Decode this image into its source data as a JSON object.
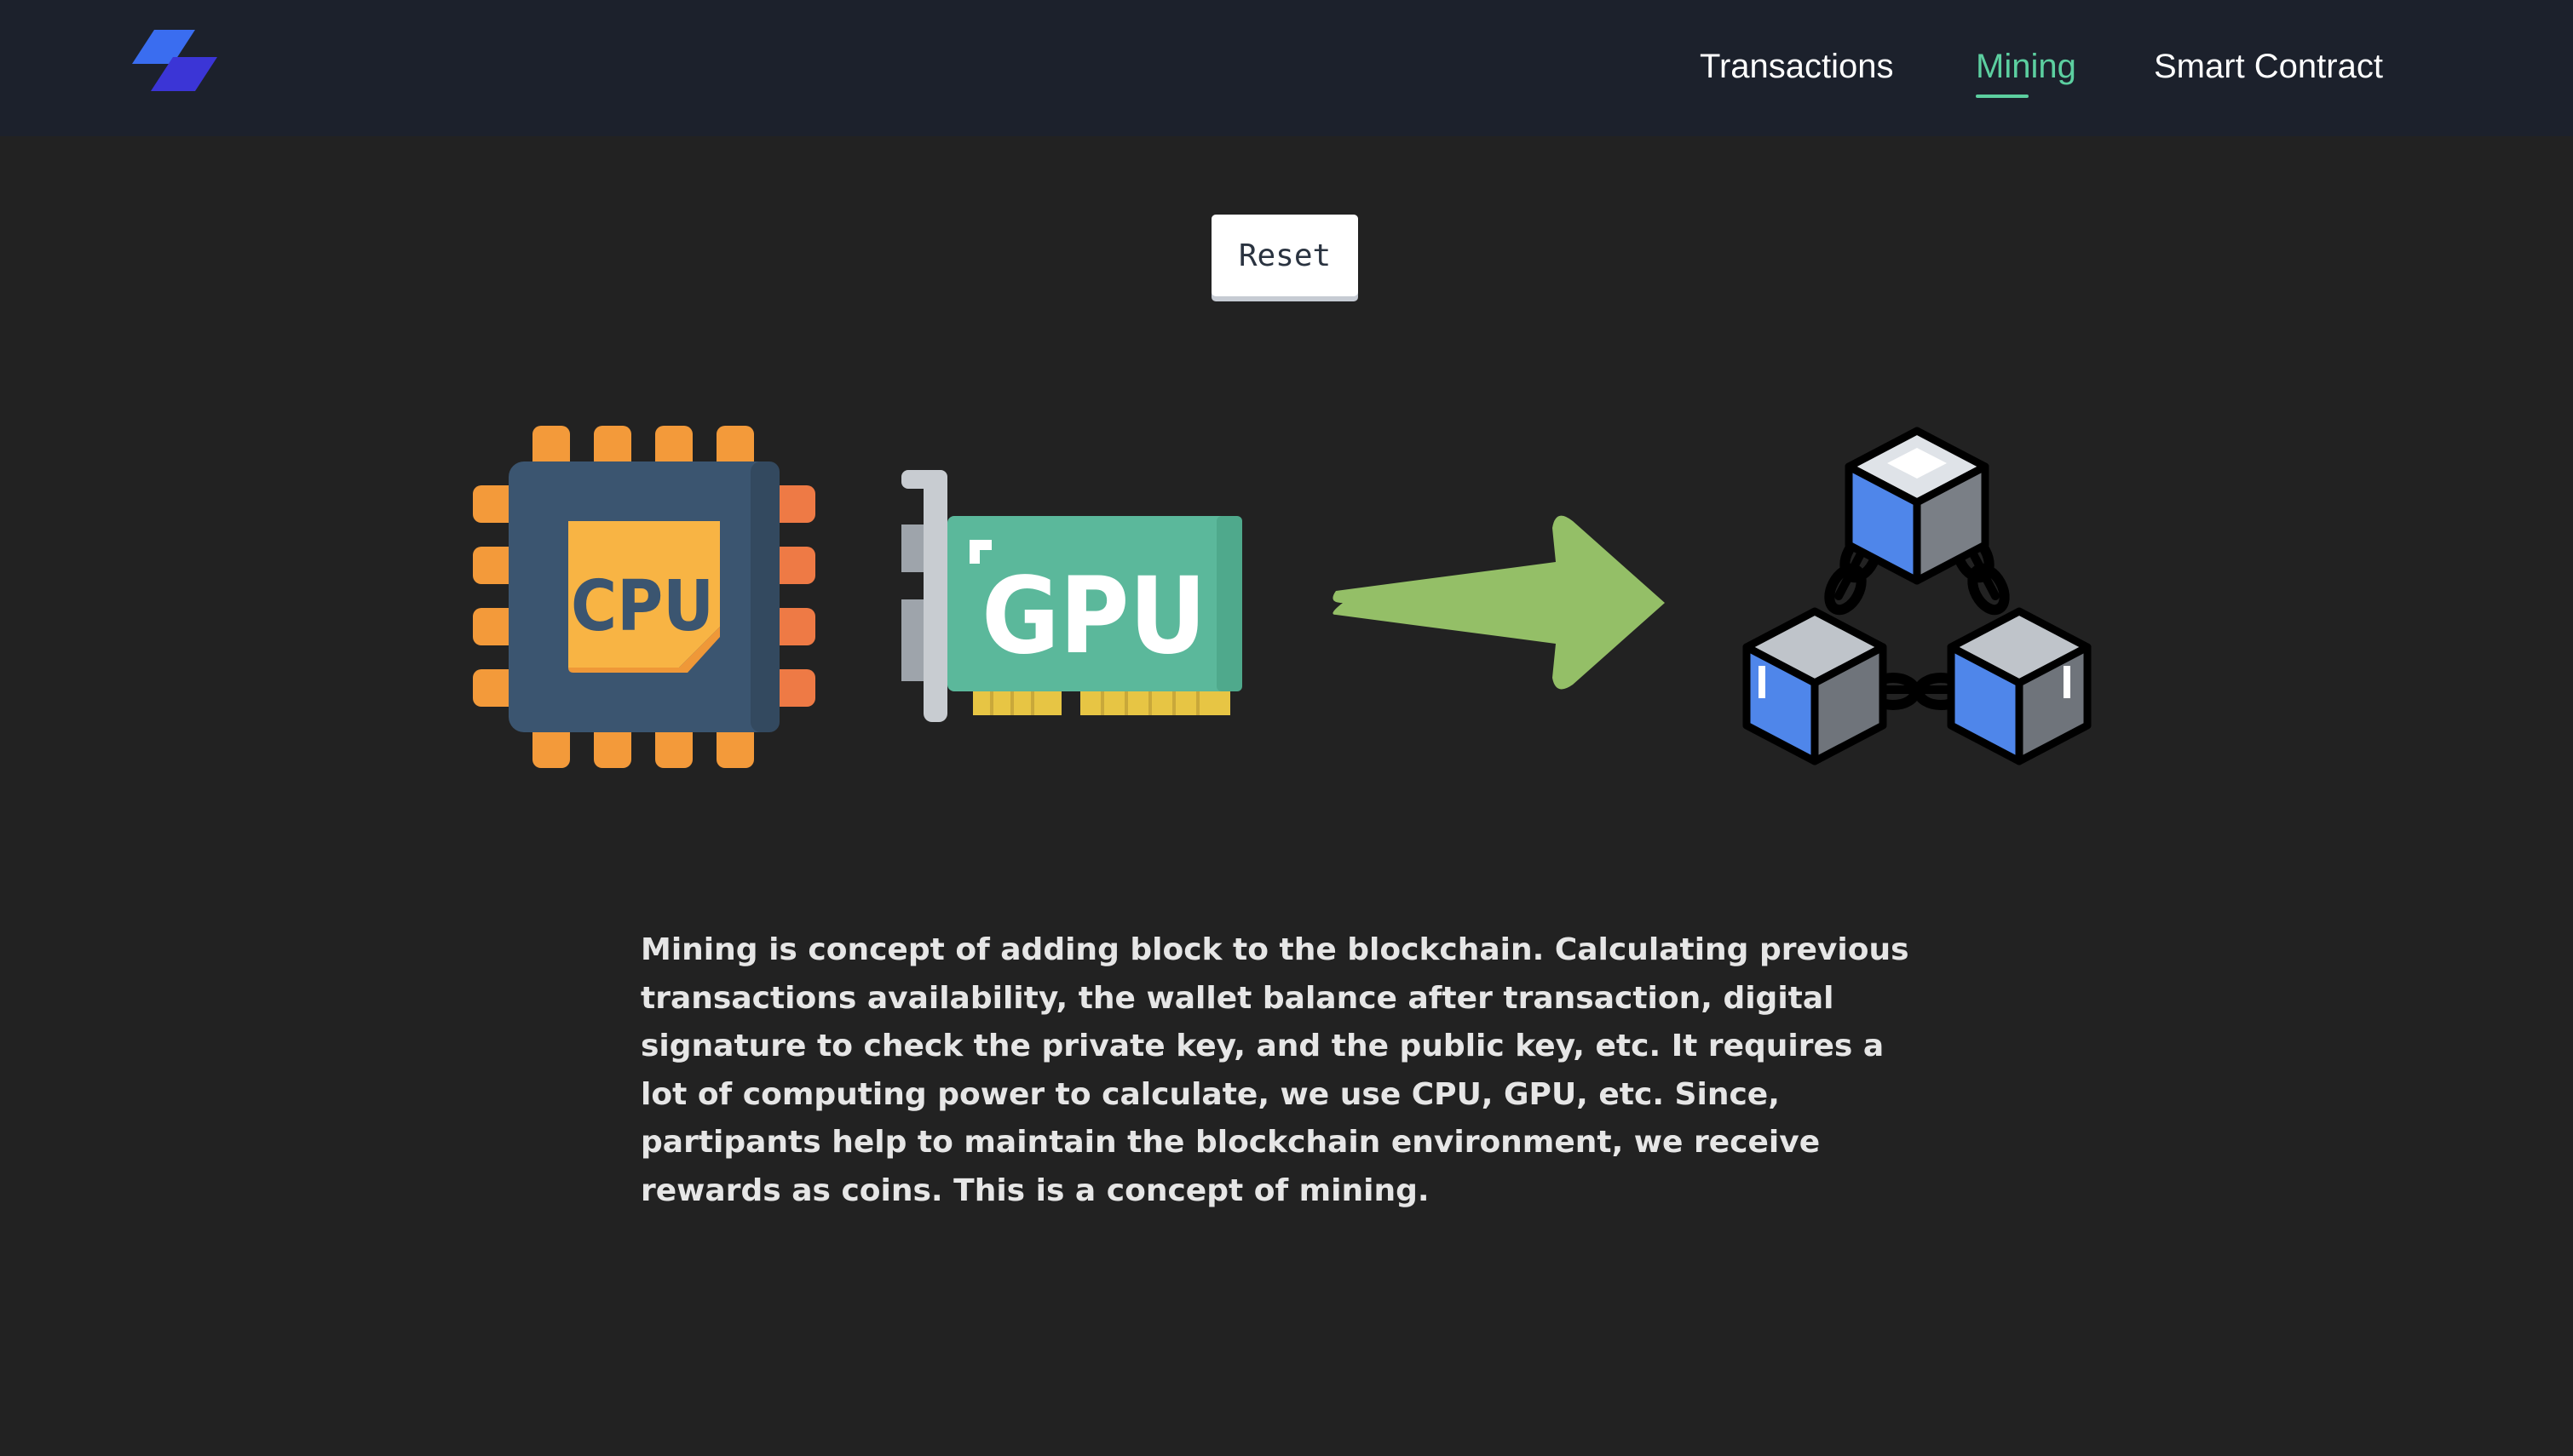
{
  "nav": {
    "items": [
      {
        "label": "Transactions",
        "active": false
      },
      {
        "label": "Mining",
        "active": true
      },
      {
        "label": "Smart Contract",
        "active": false
      }
    ]
  },
  "reset_button": {
    "label": "Reset"
  },
  "illustration": {
    "cpu_label": "CPU",
    "gpu_label": "GPU",
    "icons": [
      "cpu-chip-icon",
      "gpu-card-icon",
      "arrow-right-icon",
      "blockchain-network-icon"
    ]
  },
  "description": "Mining is concept of adding block to the blockchain. Calculating previous transactions availability, the wallet balance after transaction, digital signature to check the private key, and the public key, etc. It requires a lot of computing power to calculate, we use CPU, GPU, etc. Since, partipants help to maintain the blockchain environment, we receive rewards as coins. This is a concept of mining.",
  "colors": {
    "header_bg": "#1c212c",
    "page_bg": "#222222",
    "accent": "#5ccfa0",
    "logo_blue": "#3a6df0",
    "logo_indigo": "#3b35d6"
  }
}
